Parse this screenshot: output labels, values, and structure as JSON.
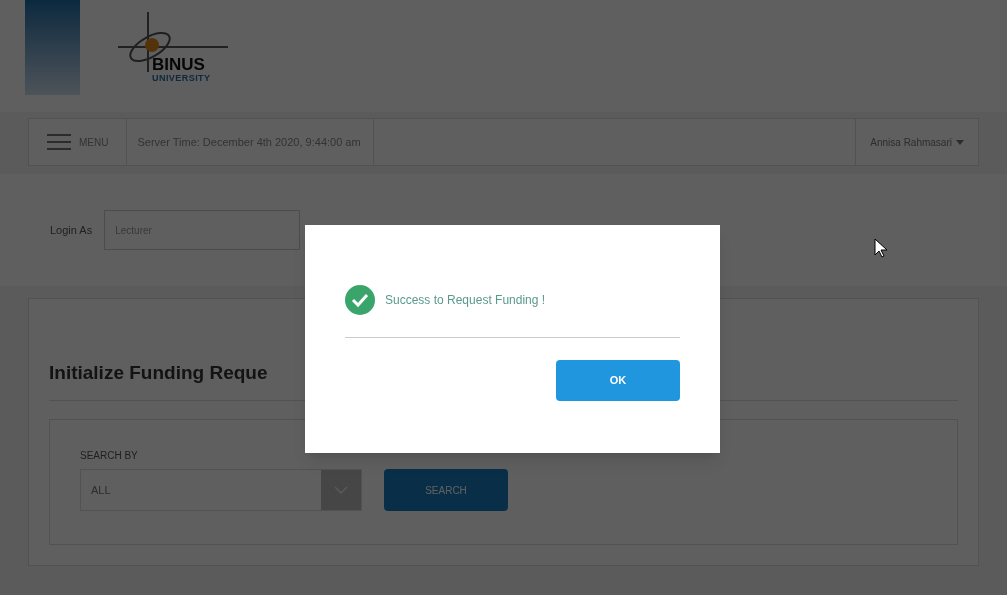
{
  "logo": {
    "name": "BINUS",
    "subtitle": "UNIVERSITY"
  },
  "navbar": {
    "menu_label": "MENU",
    "server_time": "Server Time: December 4th 2020, 9:44:00 am",
    "user": "Annisa Rahmasari"
  },
  "login_as": {
    "label": "Login As",
    "value": "Lecturer"
  },
  "card": {
    "title": "Initialize Funding Reque",
    "search_by_label": "SEARCH BY",
    "search_by_value": "ALL",
    "search_button": "SEARCH"
  },
  "dialog": {
    "message": "Success to Request Funding !",
    "ok_button": "OK"
  }
}
